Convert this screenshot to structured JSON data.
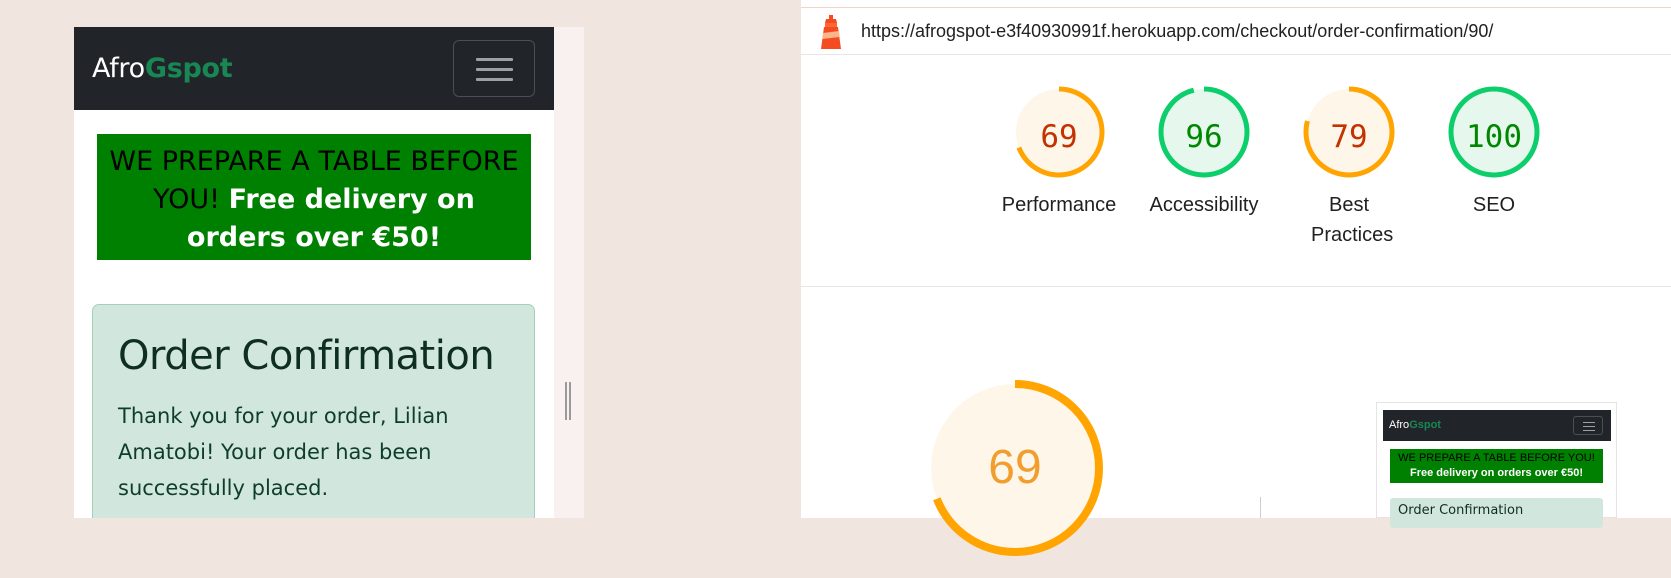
{
  "preview": {
    "brand_part1": "Afro",
    "brand_part2": "Gspot",
    "banner_dark": "WE PREPARE A TABLE BEFORE YOU!",
    "banner_light": "Free delivery on orders over €50!",
    "card_title": "Order Confirmation",
    "card_text": "Thank you for your order, Lilian Amatobi! Your order has been successfully placed."
  },
  "report": {
    "url": "https://afrogspot-e3f40930991f.herokuapp.com/checkout/order-confirmation/90/",
    "scores": [
      {
        "label": "Performance",
        "score": "69",
        "color": "#c33300",
        "ring": "#ffa400",
        "fill": "#fff6ea"
      },
      {
        "label": "Accessibility",
        "score": "96",
        "color": "#008800",
        "ring": "#0cce6b",
        "fill": "#e6f8ee"
      },
      {
        "label": "Best Practices",
        "score": "79",
        "color": "#c33300",
        "ring": "#ffa400",
        "fill": "#fff6ea"
      },
      {
        "label": "SEO",
        "score": "100",
        "color": "#008800",
        "ring": "#0cce6b",
        "fill": "#e6f8ee"
      }
    ],
    "big_score": "69",
    "thumbnail": {
      "brand_part1": "Afro",
      "brand_part2": "Gspot",
      "banner_dark": "WE PREPARE A TABLE BEFORE YOU!",
      "banner_light": "Free delivery on orders over €50!",
      "card_title": "Order Confirmation"
    }
  },
  "icons": {
    "menu": "hamburger-menu-icon",
    "lighthouse": "lighthouse-icon",
    "resize": "resize-handle-icon"
  }
}
